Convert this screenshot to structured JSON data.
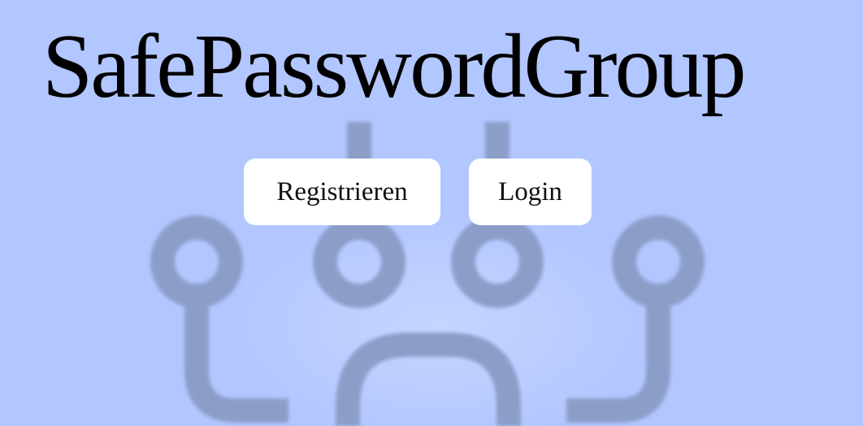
{
  "header": {
    "title": "SafePasswordGroup"
  },
  "actions": {
    "register_label": "Registrieren",
    "login_label": "Login"
  },
  "background": {
    "icon": "network-nodes-icon",
    "color": "#b2c6ff",
    "icon_color": "#8a9cc6"
  }
}
